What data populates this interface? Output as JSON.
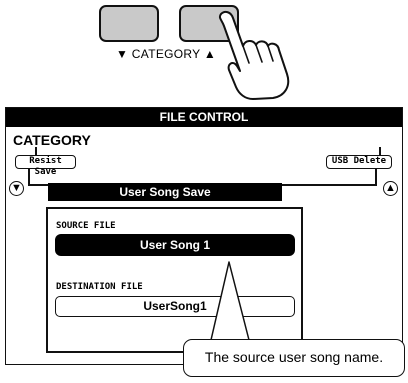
{
  "panel": {
    "category_label": "▼ CATEGORY ▲"
  },
  "lcd": {
    "title": "FILE CONTROL",
    "category": "CATEGORY",
    "left_item": "Resist Save",
    "right_item": "USB Delete",
    "left_arrow": "▼",
    "right_arrow": "▲",
    "window_title": "User Song Save",
    "source_label": "SOURCE FILE",
    "source_value": "User Song 1",
    "destination_label": "DESTINATION FILE",
    "destination_value": "UserSong1"
  },
  "callout": {
    "text": "The source user song name."
  }
}
